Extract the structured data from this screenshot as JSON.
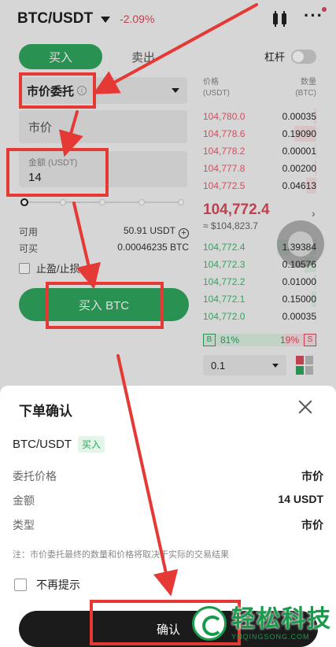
{
  "header": {
    "pair": "BTC/USDT",
    "change": "-2.09%"
  },
  "trade_tabs": {
    "buy": "买入",
    "sell": "卖出"
  },
  "leverage_label": "杠杆",
  "form": {
    "order_type": "市价委托",
    "price_placeholder": "市价",
    "amount_label": "金额 (USDT)",
    "amount_value": "14",
    "slider_percent": 0
  },
  "balances": {
    "available_label": "可用",
    "available_value": "50.91 USDT",
    "can_buy_label": "可买",
    "can_buy_value": "0.00046235 BTC"
  },
  "tpsl_label": "止盈/止损",
  "buy_button": "买入 BTC",
  "orderbook": {
    "price_header": "价格",
    "price_unit": "(USDT)",
    "qty_header": "数量",
    "qty_unit": "(BTC)",
    "asks": [
      {
        "price": "104,780.0",
        "qty": "0.00035",
        "depth": 0.05
      },
      {
        "price": "104,778.6",
        "qty": "0.19090",
        "depth": 0.55
      },
      {
        "price": "104,778.2",
        "qty": "0.00001",
        "depth": 0.02
      },
      {
        "price": "104,777.8",
        "qty": "0.00200",
        "depth": 0.04
      },
      {
        "price": "104,772.5",
        "qty": "0.04613",
        "depth": 0.26
      }
    ],
    "mid_price": "104,772.4",
    "mid_usd": "≈ $104,823.7",
    "bids": [
      {
        "price": "104,772.4",
        "qty": "1.39384",
        "depth": 1.0
      },
      {
        "price": "104,772.3",
        "qty": "0.10576",
        "depth": 0.3
      },
      {
        "price": "104,772.2",
        "qty": "0.01000",
        "depth": 0.06
      },
      {
        "price": "104,772.1",
        "qty": "0.15000",
        "depth": 0.12
      },
      {
        "price": "104,772.0",
        "qty": "0.00035",
        "depth": 0.02
      }
    ],
    "buy_tag": "B",
    "buy_pct": "81%",
    "sell_tag": "S",
    "sell_pct": "19%",
    "depth_value": "0.1"
  },
  "modal": {
    "title": "下单确认",
    "pair": "BTC/USDT",
    "side_badge": "买入",
    "rows": [
      {
        "label": "委托价格",
        "value": "市价"
      },
      {
        "label": "金额",
        "value": "14 USDT"
      },
      {
        "label": "类型",
        "value": "市价"
      }
    ],
    "note": "注：市价委托最终的数量和价格将取决于实际的交易结果",
    "no_remind": "不再提示",
    "confirm": "确认"
  },
  "watermark": {
    "title": "轻松科技",
    "url": "YNQINGSONG.COM"
  },
  "colors": {
    "green": "#2fa55e",
    "red": "#d94a5c",
    "annotation": "#e53935"
  }
}
